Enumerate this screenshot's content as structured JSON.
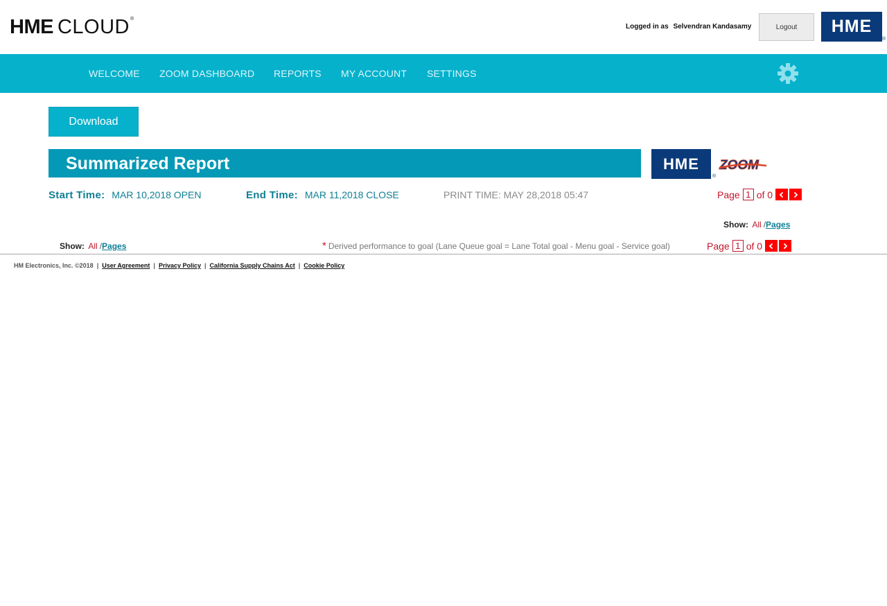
{
  "header": {
    "brand_bold": "HME",
    "brand_light": "CLOUD",
    "brand_reg": "®",
    "logged_in_label": "Logged in as",
    "user_name": "Selvendran Kandasamy",
    "logout_label": "Logout",
    "logo_text": "HME",
    "logo_reg": "®"
  },
  "nav": {
    "items": [
      "WELCOME",
      "ZOOM DASHBOARD",
      "REPORTS",
      "MY ACCOUNT",
      "SETTINGS"
    ],
    "settings_icon": "gear-icon"
  },
  "toolbar": {
    "download_label": "Download"
  },
  "report": {
    "title": "Summarized Report",
    "logo_text": "HME",
    "logo_reg": "®",
    "zoom_logo_text": "ZOOM",
    "start_label": "Start Time:",
    "start_value": "MAR 10,2018 OPEN",
    "end_label": "End Time:",
    "end_value": "MAR 11,2018 CLOSE",
    "print_time": "PRINT TIME: MAY 28,2018 05:47"
  },
  "pager_top": {
    "page_label": "Page",
    "current": "1",
    "of_label": "of 0"
  },
  "show_top": {
    "label": "Show:",
    "all": "All",
    "sep": "/",
    "pages": "Pages"
  },
  "show_bottom": {
    "label": "Show:",
    "all": "All",
    "sep": "/",
    "pages": "Pages"
  },
  "note": {
    "star": "*",
    "text": "Derived performance to goal (Lane Queue goal = Lane Total goal - Menu goal - Service goal)"
  },
  "pager_bottom": {
    "page_label": "Page",
    "current": "1",
    "of_label": "of 0"
  },
  "footer": {
    "copyright": "HM Electronics, Inc. ©2018",
    "links": [
      "User Agreement",
      "Privacy Policy",
      "California Supply Chains Act",
      "Cookie Policy"
    ]
  },
  "colors": {
    "nav_bg": "#06b1cc",
    "banner_bg": "#0499b6",
    "hme_blue": "#0b3a7a",
    "accent_red": "#c0172c",
    "arrow_red": "#ff0000",
    "teal_text": "#0e7f94"
  }
}
